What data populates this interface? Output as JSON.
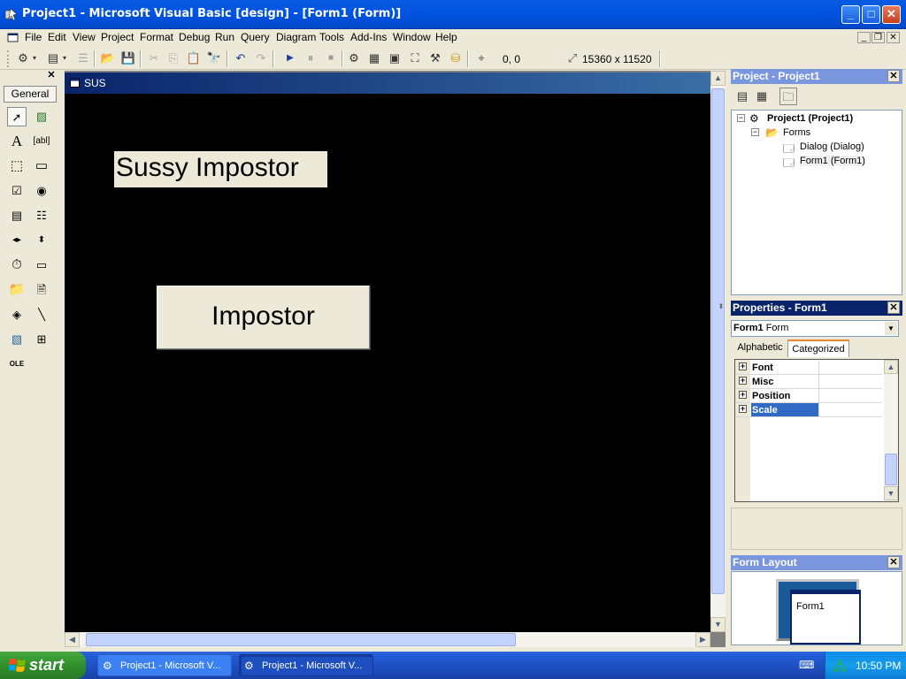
{
  "window": {
    "title": "Project1 - Microsoft Visual Basic [design] - [Form1 (Form)]",
    "min": "_",
    "max": "□",
    "close": "✕"
  },
  "menu": [
    "File",
    "Edit",
    "View",
    "Project",
    "Format",
    "Debug",
    "Run",
    "Query",
    "Diagram",
    "Tools",
    "Add-Ins",
    "Window",
    "Help"
  ],
  "toolbar": {
    "position": "0, 0",
    "size": "15360 x 11520"
  },
  "toolbox": {
    "tab": "General",
    "close": "✕"
  },
  "form": {
    "caption": "SUS",
    "label_text": "Sussy Impostor",
    "button_text": "Impostor"
  },
  "project_panel": {
    "title": "Project - Project1",
    "root": "Project1 (Project1)",
    "folder": "Forms",
    "items": [
      "Dialog (Dialog)",
      "Form1 (Form1)"
    ]
  },
  "properties_panel": {
    "title": "Properties - Form1",
    "object_name": "Form1",
    "object_type": "Form",
    "tabs": [
      "Alphabetic",
      "Categorized"
    ],
    "categories": [
      "Font",
      "Misc",
      "Position",
      "Scale"
    ]
  },
  "layout_panel": {
    "title": "Form Layout",
    "form_name": "Form1"
  },
  "taskbar": {
    "start": "start",
    "tasks": [
      "Project1 - Microsoft V...",
      "Project1 - Microsoft V..."
    ],
    "clock": "10:50 PM"
  },
  "colors": {
    "titlebar": "#0054e3",
    "panel_title_active": "#0a246a",
    "form_background": "#000000",
    "selected_row": "#316ac5"
  }
}
